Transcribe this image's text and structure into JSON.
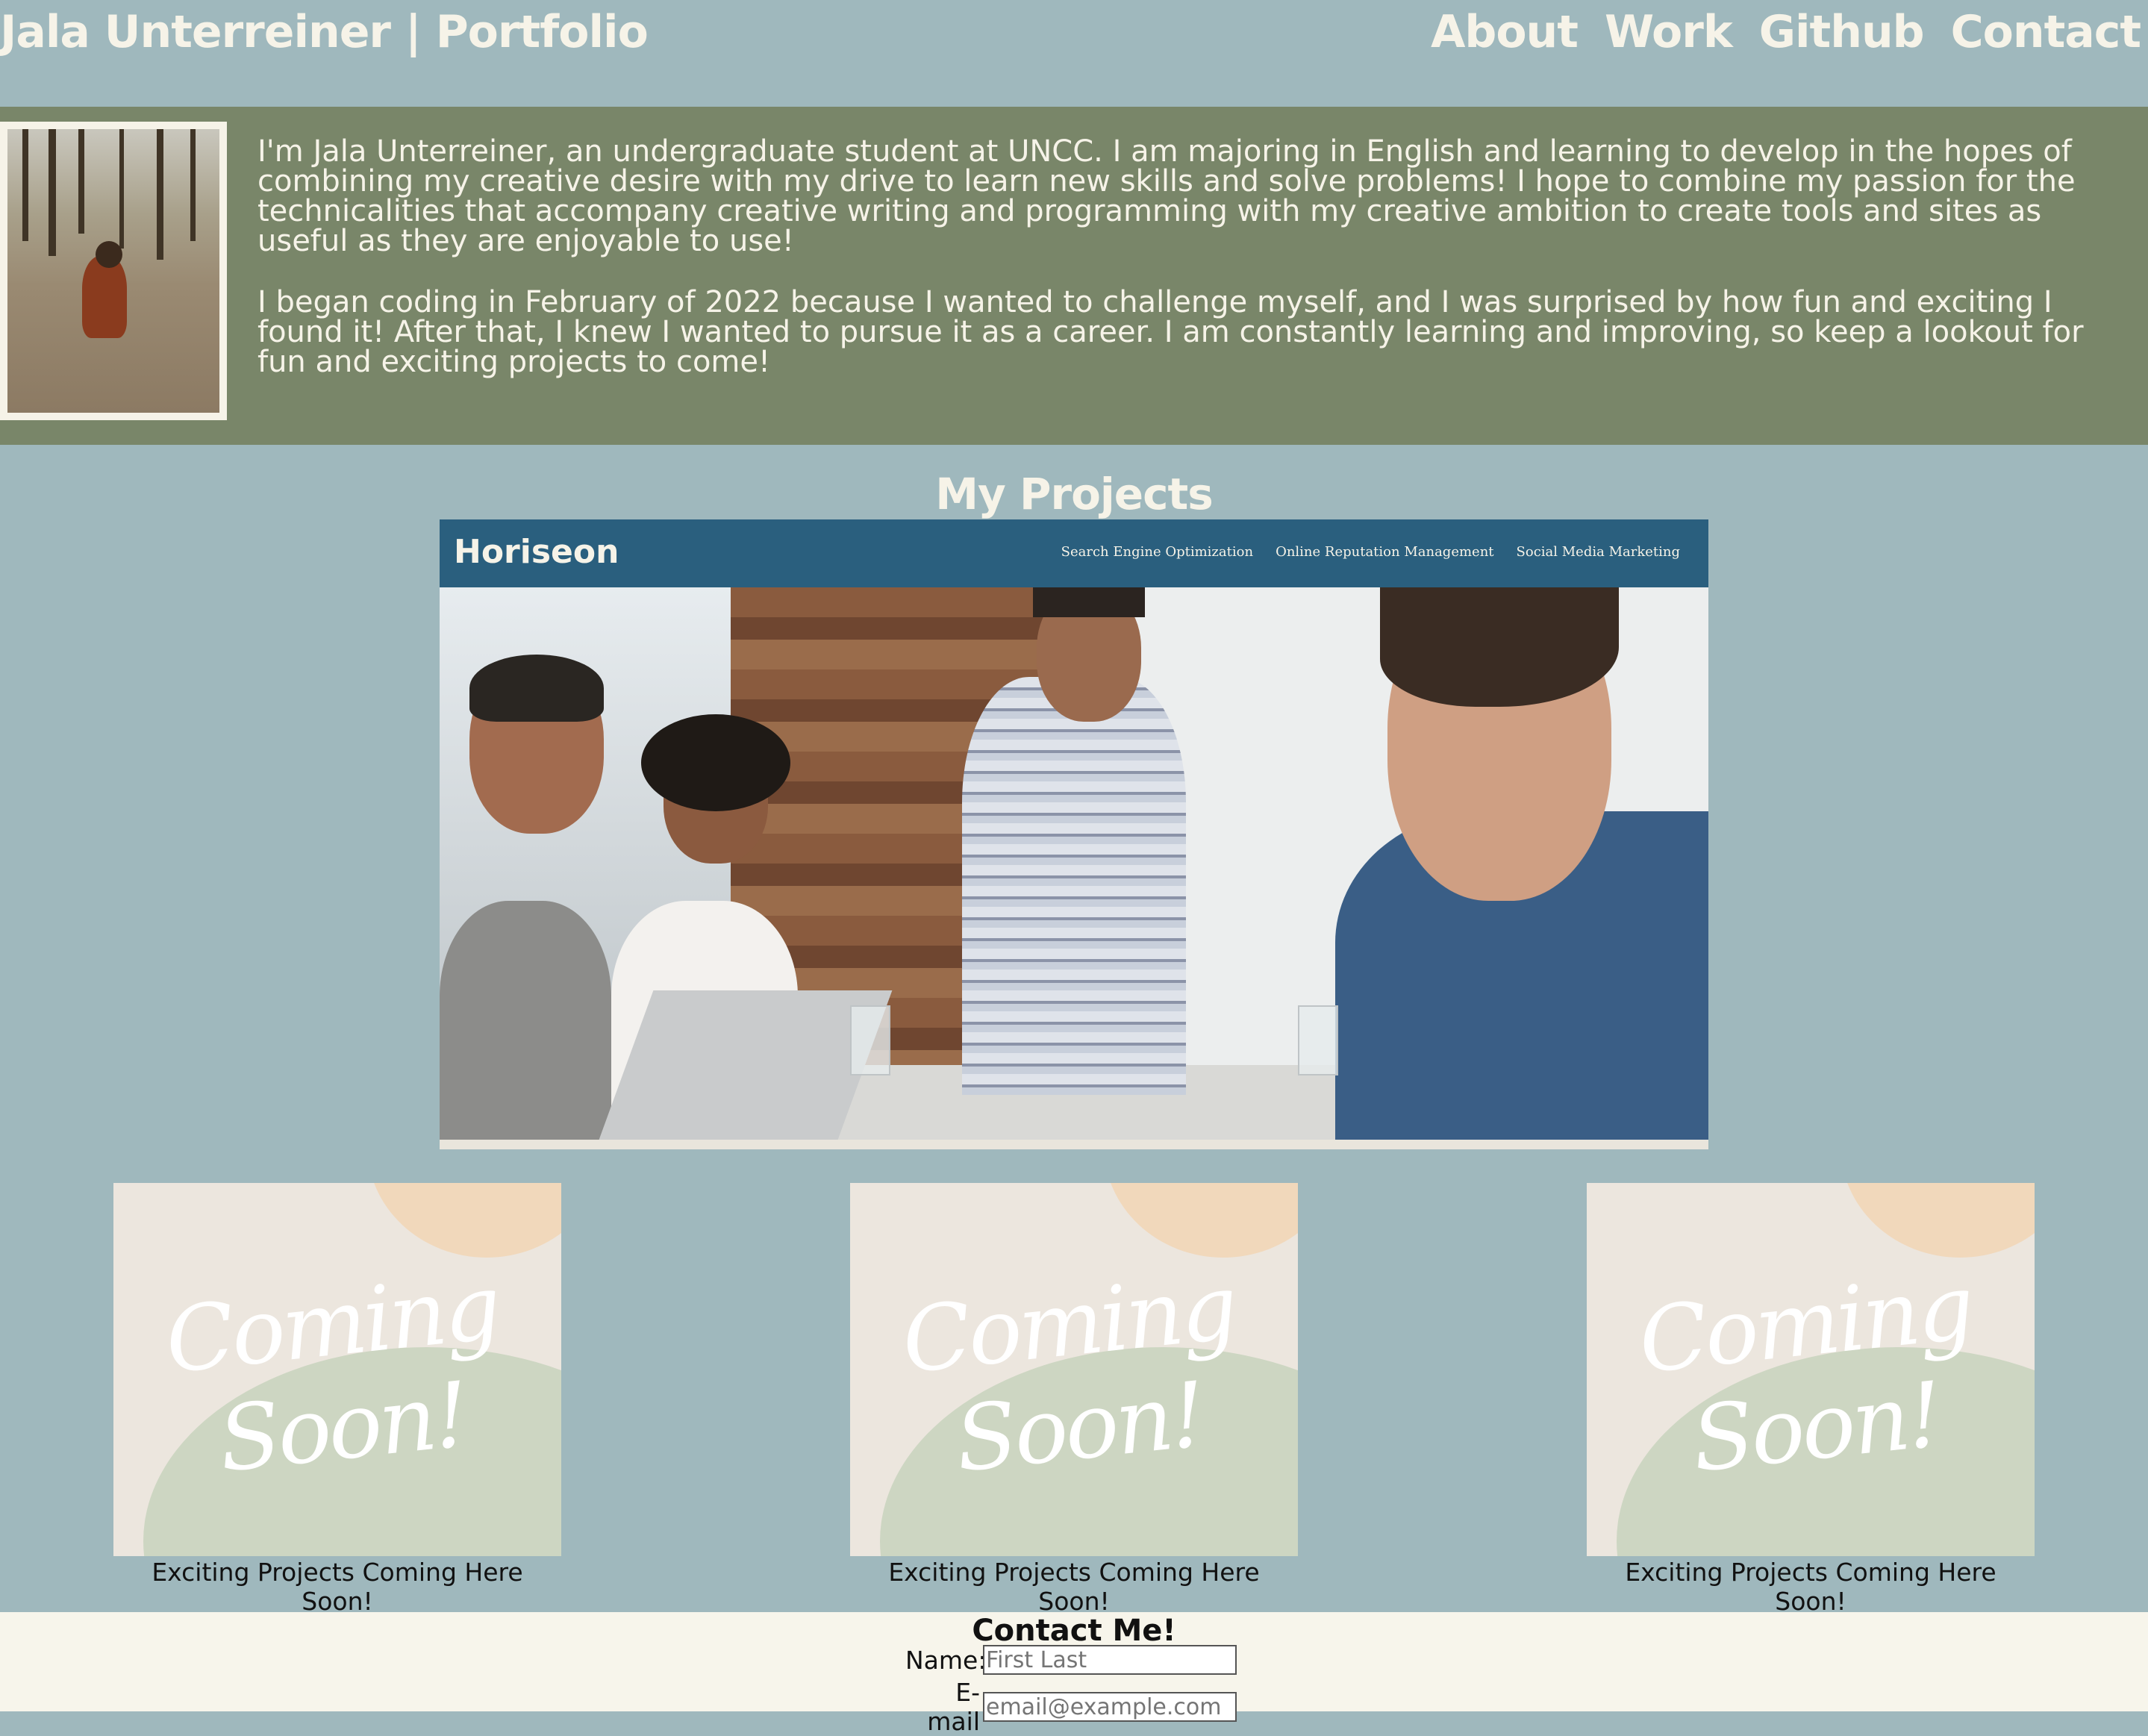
{
  "header": {
    "title": "Jala Unterreiner | Portfolio",
    "nav": [
      "About",
      "Work",
      "Github",
      "Contact"
    ]
  },
  "about": {
    "paragraphs": [
      "I'm Jala Unterreiner, an undergraduate student at UNCC. I am majoring in English and learning to develop in the hopes of combining my creative desire with my drive to learn new skills and solve problems! I hope to combine my passion for the technicalities that accompany creative writing and programming with my creative ambition to create tools and sites as useful as they are enjoyable to use!",
      "I began coding in February of 2022 because I wanted to challenge myself, and I was surprised by how fun and exciting I found it! After that, I knew I wanted to pursue it as a career. I am constantly learning and improving, so keep a lookout for fun and exciting projects to come!"
    ]
  },
  "projects": {
    "title": "My Projects",
    "featured": {
      "brand": "Horiseon",
      "nav": [
        "Search Engine Optimization",
        "Online Reputation Management",
        "Social Media Marketing"
      ]
    },
    "cards": [
      {
        "image_text": "Coming Soon!",
        "caption": "Exciting Projects Coming Here Soon!"
      },
      {
        "image_text": "Coming Soon!",
        "caption": "Exciting Projects Coming Here Soon!"
      },
      {
        "image_text": "Coming Soon!",
        "caption": "Exciting Projects Coming Here Soon!"
      }
    ]
  },
  "contact": {
    "title": "Contact Me!",
    "name_label": "Name:",
    "name_placeholder": "First Last",
    "email_label": "E-mail",
    "email_placeholder": "email@example.com"
  },
  "colors": {
    "header_bg": "#9fb8bd",
    "about_bg": "#798669",
    "text_light": "#f6f3e8",
    "featured_bar": "#2a5f7e",
    "contact_bg": "#f7f5eb"
  }
}
